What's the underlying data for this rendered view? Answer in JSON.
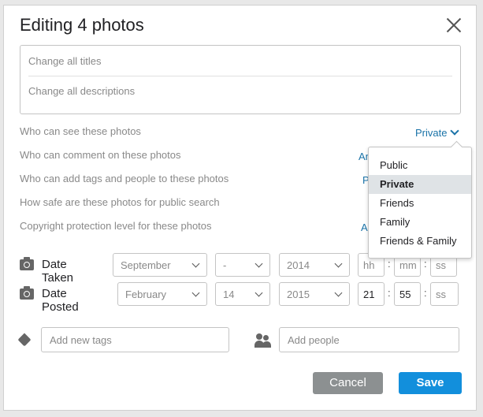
{
  "dialog": {
    "title": "Editing 4 photos",
    "titles_placeholder": "Change all titles",
    "descriptions_placeholder": "Change all descriptions"
  },
  "permissions": {
    "see_label": "Who can see these photos",
    "see_value": "Private",
    "comment_label": "Who can comment on these photos",
    "comment_value_partial": "An",
    "tags_label": "Who can add tags and people to these photos",
    "tags_value_partial": "P",
    "safety_label": "How safe are these photos for public search",
    "copyright_label": "Copyright protection level for these photos",
    "copyright_value_partial": "A"
  },
  "privacy_dropdown": {
    "options": [
      "Public",
      "Private",
      "Friends",
      "Family",
      "Friends & Family"
    ],
    "selected": "Private"
  },
  "date_taken": {
    "label": "Date Taken",
    "month": "September",
    "day": "-",
    "year": "2014",
    "hh": "hh",
    "mm": "mm",
    "ss": "ss"
  },
  "date_posted": {
    "label": "Date Posted",
    "month": "February",
    "day": "14",
    "year": "2015",
    "hh": "21",
    "mm": "55",
    "ss": "ss"
  },
  "tags": {
    "placeholder": "Add new tags"
  },
  "people": {
    "placeholder": "Add people"
  },
  "buttons": {
    "cancel": "Cancel",
    "save": "Save"
  },
  "icons": {
    "close": "close-icon",
    "chevron": "chevron-down-icon",
    "camera": "camera-icon",
    "tag": "tag-icon",
    "people": "people-icon"
  },
  "colors": {
    "accent": "#1a73a8",
    "save_button": "#128fdc",
    "cancel_button": "#8c9091",
    "selected_option_bg": "#dfe3e6"
  }
}
